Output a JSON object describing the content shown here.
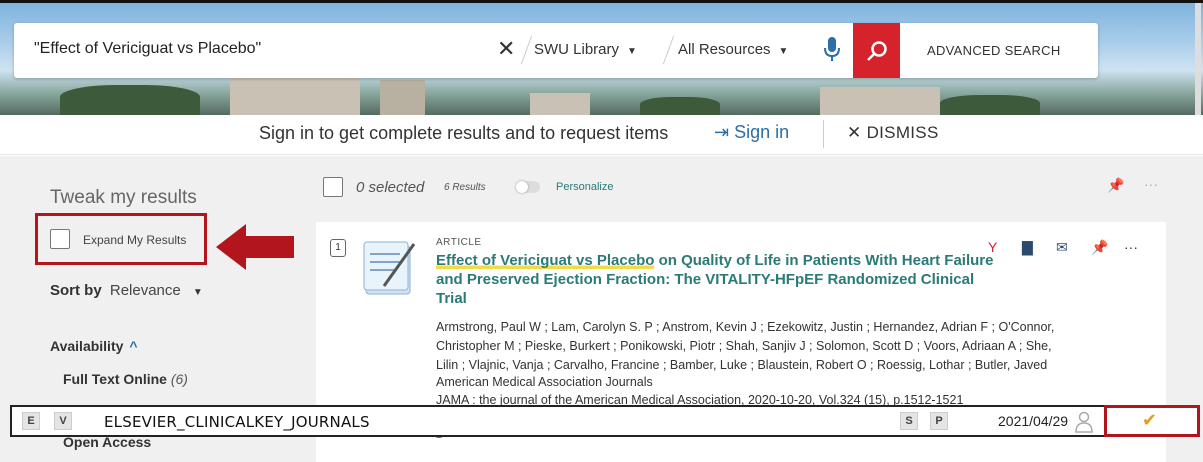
{
  "search": {
    "query": "\"Effect of Vericiguat vs Placebo\"",
    "scope": "SWU Library",
    "resources": "All Resources",
    "advanced_label": "ADVANCED SEARCH"
  },
  "signin_bar": {
    "message": "Sign in to get complete results and to request items",
    "signin_label": "Sign in",
    "dismiss_label": "DISMISS"
  },
  "facets": {
    "tweak_title": "Tweak my results",
    "expand_label": "Expand My Results",
    "sort_by_label": "Sort by",
    "sort_value": "Relevance",
    "availability_label": "Availability",
    "availability_items": [
      {
        "label": "Full Text Online",
        "count": "(6)"
      },
      {
        "label": "Open Access",
        "count": ""
      }
    ]
  },
  "results_header": {
    "selected": "0 selected",
    "results_count": "6 Results",
    "personalize": "Personalize"
  },
  "result": {
    "number": "1",
    "type": "ARTICLE",
    "title_highlight": "Effect of Vericiguat vs Placebo",
    "title_rest": " on Quality of Life in Patients With Heart Failure and Preserved Ejection Fraction: The VITALITY-HFpEF Randomized Clinical Trial",
    "authors": "Armstrong, Paul W ; Lam, Carolyn S. P ; Anstrom, Kevin J ; Ezekowitz, Justin ; Hernandez, Adrian F ; O'Connor, Christopher M ; Pieske, Burkert ; Ponikowski, Piotr ; Shah, Sanjiv J ; Solomon, Scott D ; Voors, Adriaan A ; She, Lilin ; Vlajnic, Vanja ; Carvalho, Francine ; Bamber, Luke ; Blaustein, Robert O ; Roessig, Lothar ; Butler, Javed",
    "source": "American Medical Association Journals",
    "citation": "JAMA : the journal of the American Medical Association, 2020-10-20, Vol.324 (15), p.1512-1521"
  },
  "overlay": {
    "tag_e": "E",
    "tag_v": "V",
    "collection": "ELSEVIER_CLINICALKEY_JOURNALS",
    "tag_s": "S",
    "tag_p": "P",
    "date": "2021/04/29",
    "check_glyph": "✔"
  },
  "colors": {
    "accent_red": "#d6232b",
    "annotation_red": "#b3151c",
    "link_teal": "#2b7a78",
    "link_blue": "#2b6ea8"
  }
}
